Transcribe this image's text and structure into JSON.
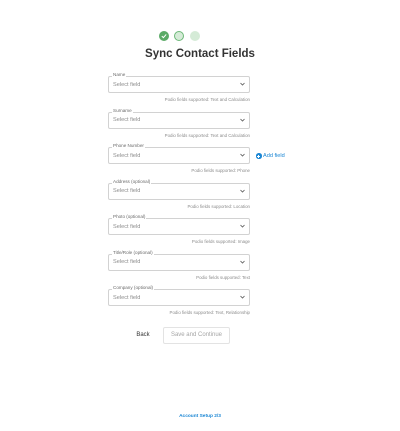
{
  "title": "Sync Contact Fields",
  "fields": [
    {
      "label": "Name",
      "value": "Select field",
      "hint": "Podio fields supported: Text and Calculation"
    },
    {
      "label": "Surname",
      "value": "Select field",
      "hint": "Podio fields supported: Text and Calculation"
    },
    {
      "label": "Phone Number",
      "value": "Select field",
      "hint": "Podio fields supported: Phone"
    },
    {
      "label": "Address (optional)",
      "value": "Select field",
      "hint": "Podio fields supported: Location"
    },
    {
      "label": "Photo (optional)",
      "value": "Select field",
      "hint": "Podio fields supported: Image"
    },
    {
      "label": "Title/Role (optional)",
      "value": "Select field",
      "hint": "Podio fields supported: Text"
    },
    {
      "label": "Company (optional)",
      "value": "Select field",
      "hint": "Podio fields supported: Text, Relationship"
    }
  ],
  "add_field": {
    "label": "Add field",
    "icon": "plus-circle-icon",
    "color": "#1a86d4"
  },
  "actions": {
    "back_label": "Back",
    "save_label": "Save and Continue"
  },
  "footer": "Account Setup 2/3",
  "steps": [
    {
      "state": "completed",
      "icon": "check-icon"
    },
    {
      "state": "current"
    },
    {
      "state": "upcoming"
    }
  ],
  "colors": {
    "accent": "#1a86d4",
    "step_done": "#5aaa66",
    "step_pending": "#d5ebd7"
  }
}
